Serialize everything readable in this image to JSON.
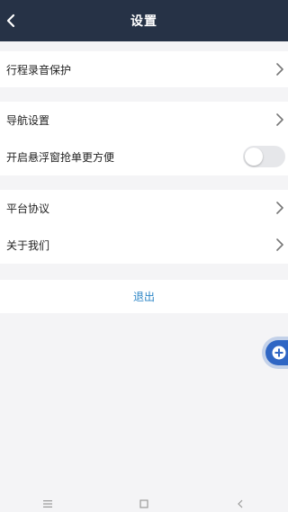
{
  "header": {
    "title": "设置"
  },
  "groups": {
    "trip": {
      "items": [
        {
          "label": "行程录音保护"
        }
      ]
    },
    "nav": {
      "items": [
        {
          "label": "导航设置"
        },
        {
          "label": "开启悬浮窗抢单更方便",
          "toggle_on": false
        }
      ]
    },
    "about": {
      "items": [
        {
          "label": "平台协议"
        },
        {
          "label": "关于我们"
        }
      ]
    }
  },
  "logout": {
    "label": "退出"
  },
  "colors": {
    "header_bg": "#263246",
    "page_bg": "#f4f4f6",
    "logout_text": "#2d86c6",
    "fab": "#2f66c4",
    "toggle_off": "#e6e7ea"
  },
  "icons": {
    "back": "back-arrow-icon",
    "chevron": "chevron-right-icon",
    "fab": "plus-icon",
    "nav_menu": "menu-icon",
    "nav_home": "home-square-icon",
    "nav_back": "back-triangle-icon"
  }
}
